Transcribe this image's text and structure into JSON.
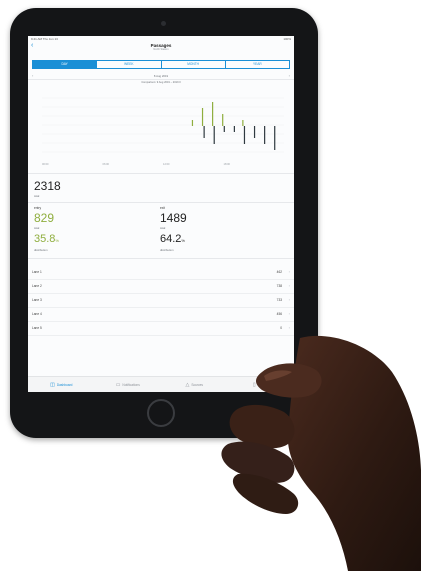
{
  "status": {
    "left": "9:41 AM  Thu Jun 13",
    "right": "100%"
  },
  "nav": {
    "back": "‹",
    "title": "Passages",
    "subtitle": "North Station"
  },
  "segments": [
    "DAY",
    "WEEK",
    "MONTH",
    "YEAR"
  ],
  "date": {
    "prev": "‹",
    "label": "8 Aug 2019",
    "next": "›"
  },
  "range": "Comparison: 9 Aug 2019 – 2019 0",
  "chart_data": {
    "type": "bar",
    "x": [
      8,
      9,
      10,
      11,
      12,
      13,
      14,
      15,
      16,
      17,
      18,
      19,
      20,
      21,
      22,
      23
    ],
    "series": [
      {
        "values": [
          0,
          0,
          0,
          0,
          0,
          0,
          0,
          1,
          3,
          4,
          2,
          0,
          1,
          0,
          0,
          0
        ]
      },
      {
        "values": [
          0,
          0,
          0,
          0,
          0,
          0,
          0,
          0,
          -2,
          -3,
          -1,
          -1,
          -3,
          -2,
          -3,
          -4
        ]
      }
    ],
    "xticks": [
      "00:00",
      "06:00",
      "12:00",
      "18:00"
    ],
    "colors": {
      "up": "#8fae3e",
      "down": "#2f3a40"
    }
  },
  "total": {
    "value": "2318",
    "label": "total"
  },
  "entry": {
    "name": "entry",
    "total": "829",
    "total_label": "total",
    "pct": "35.8",
    "pct_unit": "%",
    "pct_label": "distribution"
  },
  "exit": {
    "name": "exit",
    "total": "1489",
    "total_label": "total",
    "pct": "64.2",
    "pct_unit": "%",
    "pct_label": "distribution"
  },
  "lanes": [
    {
      "name": "Lane 1",
      "value": "462",
      "chev": "›"
    },
    {
      "name": "Lane 2",
      "value": "738",
      "chev": "›"
    },
    {
      "name": "Lane 3",
      "value": "733",
      "chev": "›"
    },
    {
      "name": "Lane 4",
      "value": "456",
      "chev": "›"
    },
    {
      "name": "Lane 5",
      "value": "0",
      "chev": "›"
    }
  ],
  "tabs": [
    {
      "label": "Dashboard",
      "icon": "◫"
    },
    {
      "label": "Notifications",
      "icon": "▭"
    },
    {
      "label": "Sources",
      "icon": "△"
    },
    {
      "label": "Options",
      "icon": "▯"
    }
  ],
  "colors": {
    "accent": "#1a8fd6",
    "entry": "#8fae3e",
    "bezel": "#141517"
  }
}
